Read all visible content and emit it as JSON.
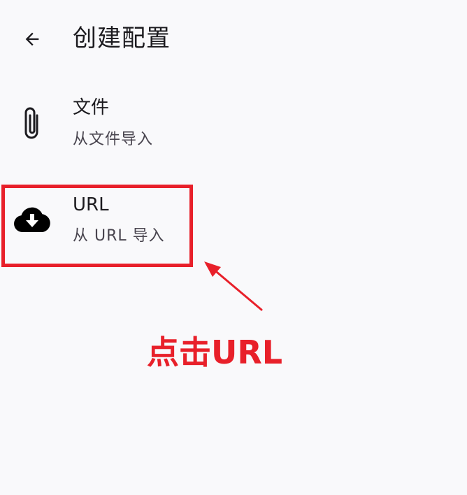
{
  "app_bar": {
    "title": "创建配置"
  },
  "options": [
    {
      "label": "文件",
      "sublabel": "从文件导入",
      "icon": "paperclip-icon"
    },
    {
      "label": "URL",
      "sublabel": "从 URL 导入",
      "icon": "cloud-download-icon"
    }
  ],
  "annotation": {
    "text": "点击URL",
    "color": "#e8202a"
  }
}
